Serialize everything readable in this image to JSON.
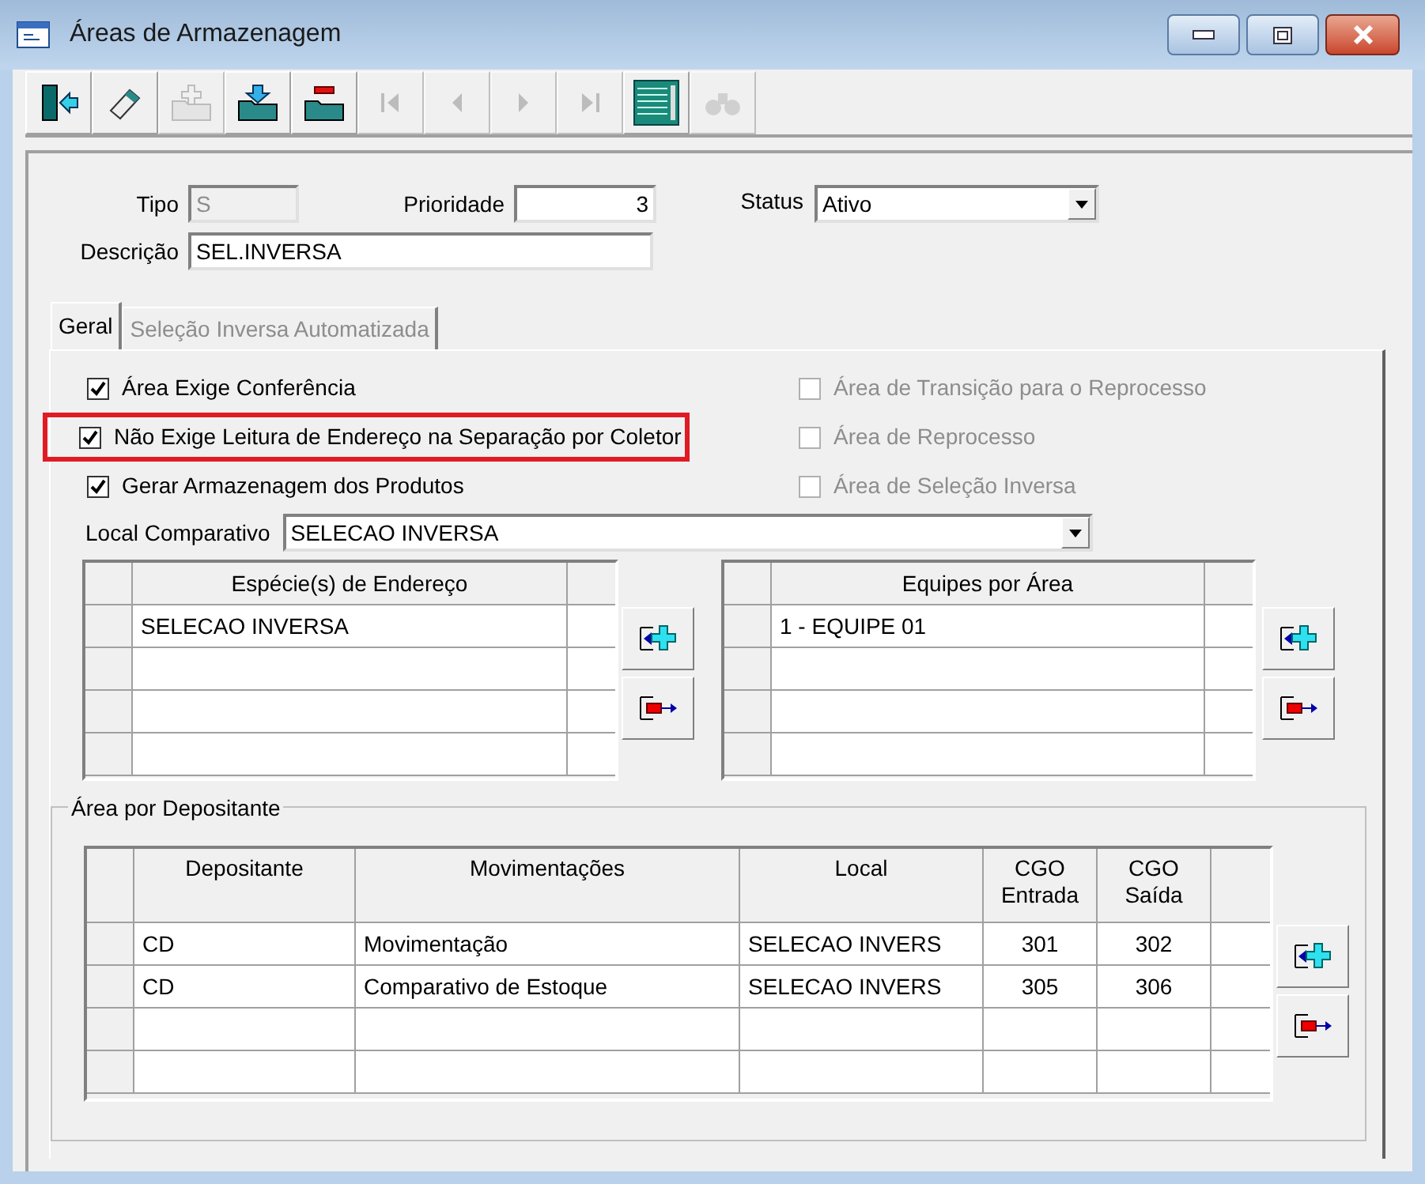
{
  "window": {
    "title": "Áreas de Armazenagem"
  },
  "toolbar": [
    {
      "kind": "exit",
      "disabled": false
    },
    {
      "kind": "edit",
      "disabled": false
    },
    {
      "kind": "add",
      "disabled": true
    },
    {
      "kind": "save",
      "disabled": false
    },
    {
      "kind": "delete",
      "disabled": false
    },
    {
      "kind": "first",
      "disabled": true
    },
    {
      "kind": "prev",
      "disabled": true
    },
    {
      "kind": "next",
      "disabled": true
    },
    {
      "kind": "last",
      "disabled": true
    },
    {
      "kind": "grid",
      "disabled": false
    },
    {
      "kind": "search",
      "disabled": true
    }
  ],
  "form": {
    "tipo": {
      "label": "Tipo",
      "value": "S",
      "disabled": true
    },
    "prioridade": {
      "label": "Prioridade",
      "value": "3"
    },
    "status": {
      "label": "Status",
      "value": "Ativo"
    },
    "descricao": {
      "label": "Descrição",
      "value": "SEL.INVERSA"
    }
  },
  "tabs": [
    {
      "label": "Geral",
      "selected": true
    },
    {
      "label": "Seleção Inversa Automatizada",
      "selected": false
    }
  ],
  "options_left": [
    {
      "label": "Área Exige Conferência",
      "checked": true,
      "disabled": false,
      "highlighted": false
    },
    {
      "label": "Não Exige Leitura de Endereço na Separação por Coletor",
      "checked": true,
      "disabled": false,
      "highlighted": true
    },
    {
      "label": "Gerar Armazenagem dos Produtos",
      "checked": true,
      "disabled": false,
      "highlighted": false
    }
  ],
  "options_right": [
    {
      "label": "Área de Transição para o Reprocesso",
      "checked": false,
      "disabled": true,
      "highlighted": false
    },
    {
      "label": "Área de Reprocesso",
      "checked": false,
      "disabled": true,
      "highlighted": false
    },
    {
      "label": "Área de Seleção Inversa",
      "checked": false,
      "disabled": true,
      "highlighted": false
    }
  ],
  "local_comparativo": {
    "label": "Local Comparativo",
    "value": "SELECAO INVERSA"
  },
  "especies_grid": {
    "column": "Espécie(s) de Endereço",
    "rows": [
      "SELECAO INVERSA"
    ]
  },
  "equipes_grid": {
    "column": "Equipes por Área",
    "rows": [
      "1 - EQUIPE 01"
    ]
  },
  "depositante_group": {
    "title": "Área por Depositante",
    "columns": [
      "Depositante",
      "Movimentações",
      "Local",
      "CGO Entrada",
      "CGO Saída"
    ],
    "rows": [
      [
        "CD",
        "Movimentação",
        "SELECAO INVERS",
        "301",
        "302"
      ],
      [
        "CD",
        "Comparativo de Estoque",
        "SELECAO INVERS",
        "305",
        "306"
      ]
    ]
  }
}
